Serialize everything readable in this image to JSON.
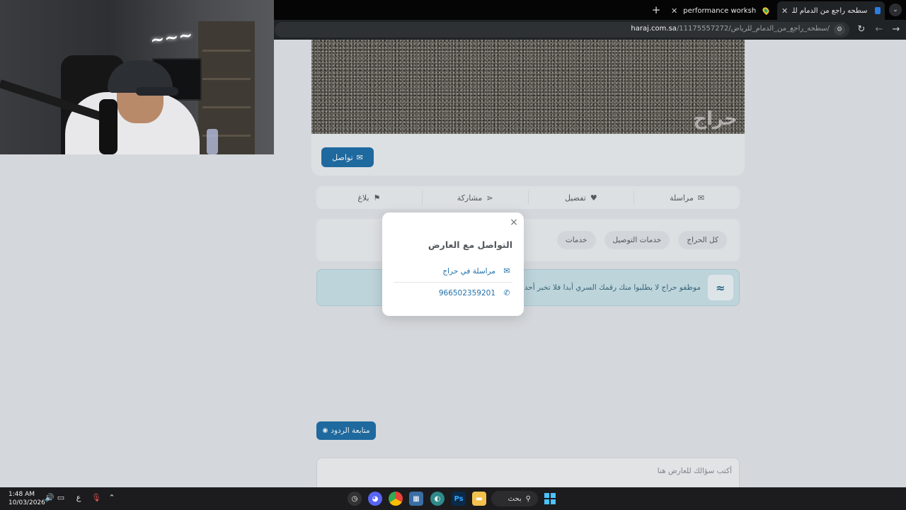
{
  "browser": {
    "tabs": [
      {
        "title": "سطحه راجع من الدمام للرياض | ح",
        "active": true
      },
      {
        "title": "Speedtech performance worksh",
        "active": false
      }
    ],
    "url_host": "haraj.com.sa",
    "url_path": "/11175557272/سطحه_راجع_من_الدمام_للرياض/"
  },
  "listing": {
    "watermark": "حراج",
    "contact_button": "تواصل",
    "actions": [
      {
        "label": "مراسلة",
        "icon": "envelope-icon"
      },
      {
        "label": "تفضيل",
        "icon": "heart-icon"
      },
      {
        "label": "مشاركة",
        "icon": "share-icon"
      },
      {
        "label": "بلاغ",
        "icon": "flag-icon"
      }
    ],
    "tags": [
      "كل الحراج",
      "خدمات التوصيل",
      "خدمات"
    ],
    "notice": "موظفو حراج لا يطلبوا منك رقمك السري أبدا فلا تخبر أحد بعد",
    "follow_button": "متابعة الردود",
    "question_placeholder": "أكتب سؤالك للعارض هنا"
  },
  "modal": {
    "close": "×",
    "title": "التواصل مع العارض",
    "message_option": "مراسلة في حراج",
    "phone": "966502359201"
  },
  "taskbar": {
    "time": "1:48 AM",
    "date": "10/03/2026",
    "lang": "ع",
    "search": "بحث"
  },
  "colors": {
    "accent": "#1f6fa8",
    "notice_bg": "#cbe3ea"
  }
}
